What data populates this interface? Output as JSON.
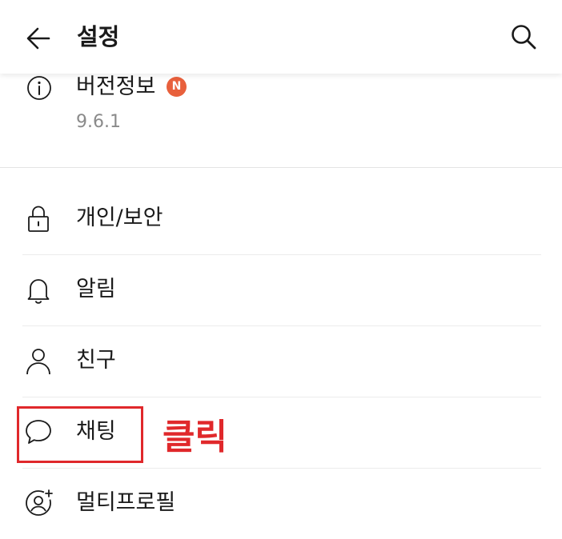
{
  "header": {
    "title": "설정"
  },
  "version": {
    "label": "버전정보",
    "badge": "N",
    "value": "9.6.1"
  },
  "menu": {
    "items": [
      {
        "label": "개인/보안",
        "icon": "lock-icon"
      },
      {
        "label": "알림",
        "icon": "bell-icon"
      },
      {
        "label": "친구",
        "icon": "person-icon"
      },
      {
        "label": "채팅",
        "icon": "chat-bubble-icon"
      },
      {
        "label": "멀티프로필",
        "icon": "multi-profile-icon"
      }
    ]
  },
  "annotation": {
    "text": "클릭",
    "color": "#e0282b"
  },
  "colors": {
    "badge": "#e8603c",
    "annotation": "#e0282b",
    "secondary_text": "#8a8a8a"
  }
}
